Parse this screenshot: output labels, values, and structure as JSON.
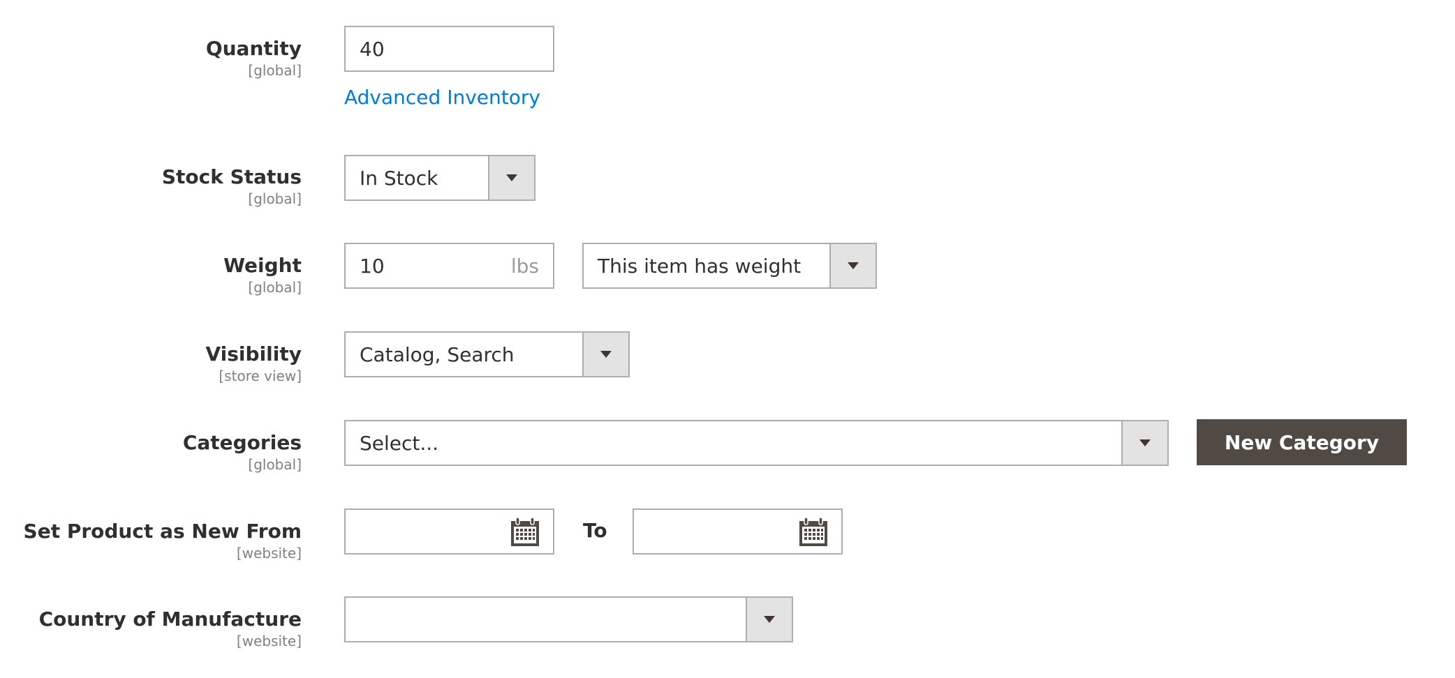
{
  "colors": {
    "label": "#303030",
    "scope": "#808080",
    "border": "#adadad",
    "arrow_bg": "#e3e3e3",
    "link": "#007bdb",
    "button_bg": "#514943"
  },
  "fields": {
    "quantity": {
      "label": "Quantity",
      "scope": "[global]",
      "value": "40",
      "link": "Advanced Inventory"
    },
    "stock_status": {
      "label": "Stock Status",
      "scope": "[global]",
      "value": "In Stock"
    },
    "weight": {
      "label": "Weight",
      "scope": "[global]",
      "value": "10",
      "unit": "lbs",
      "type_value": "This item has weight"
    },
    "visibility": {
      "label": "Visibility",
      "scope": "[store view]",
      "value": "Catalog, Search"
    },
    "categories": {
      "label": "Categories",
      "scope": "[global]",
      "placeholder": "Select...",
      "button": "New Category"
    },
    "new_from": {
      "label": "Set Product as New From",
      "scope": "[website]",
      "from_value": "",
      "to_label": "To",
      "to_value": ""
    },
    "country": {
      "label": "Country of Manufacture",
      "scope": "[website]",
      "value": ""
    }
  },
  "icons": {
    "dropdown": "chevron-down-icon",
    "calendar": "calendar-icon"
  }
}
